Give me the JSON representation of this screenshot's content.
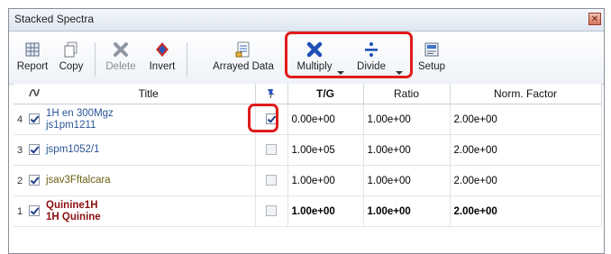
{
  "window": {
    "title": "Stacked Spectra"
  },
  "toolbar": {
    "report": "Report",
    "copy": "Copy",
    "delete": "Delete",
    "invert": "Invert",
    "arrayed_data": "Arrayed Data",
    "multiply": "Multiply",
    "divide": "Divide",
    "setup": "Setup"
  },
  "table": {
    "headers": {
      "title": "Title",
      "tg": "T/G",
      "ratio": "Ratio",
      "norm": "Norm. Factor"
    },
    "rows": [
      {
        "num": "4",
        "line1": "1H en 300Mgz",
        "line2": "js1pm1211",
        "pin_checked": true,
        "tg": "0.00e+00",
        "ratio": "1.00e+00",
        "norm": "2.00e+00"
      },
      {
        "num": "3",
        "line1": "jspm1052/1",
        "line2": "",
        "pin_checked": false,
        "tg": "1.00e+05",
        "ratio": "1.00e+00",
        "norm": "2.00e+00"
      },
      {
        "num": "2",
        "line1": "jsav3Fftalcara",
        "line2": "",
        "pin_checked": false,
        "tg": "1.00e+00",
        "ratio": "1.00e+00",
        "norm": "2.00e+00"
      },
      {
        "num": "1",
        "line1": "Quinine1H",
        "line2": "1H Quinine",
        "pin_checked": false,
        "tg": "1.00e+00",
        "ratio": "1.00e+00",
        "norm": "2.00e+00"
      }
    ]
  },
  "icons": {
    "report": "report-icon",
    "copy": "copy-icon",
    "delete": "delete-icon",
    "invert": "invert-icon",
    "arrayed_data": "arrayed-data-icon",
    "multiply": "multiply-icon",
    "divide": "divide-icon",
    "setup": "setup-icon",
    "title_header": "spectrum-icon",
    "pin_header": "pin-icon",
    "close": "close-icon"
  },
  "colors": {
    "highlight": "#e01b1b",
    "multiply_icon": "#1f4fb5",
    "divide_icon": "#1f4fb5",
    "title_blue": "#2a5599",
    "title_olive": "#6b5e12",
    "title_red": "#8c1010"
  }
}
